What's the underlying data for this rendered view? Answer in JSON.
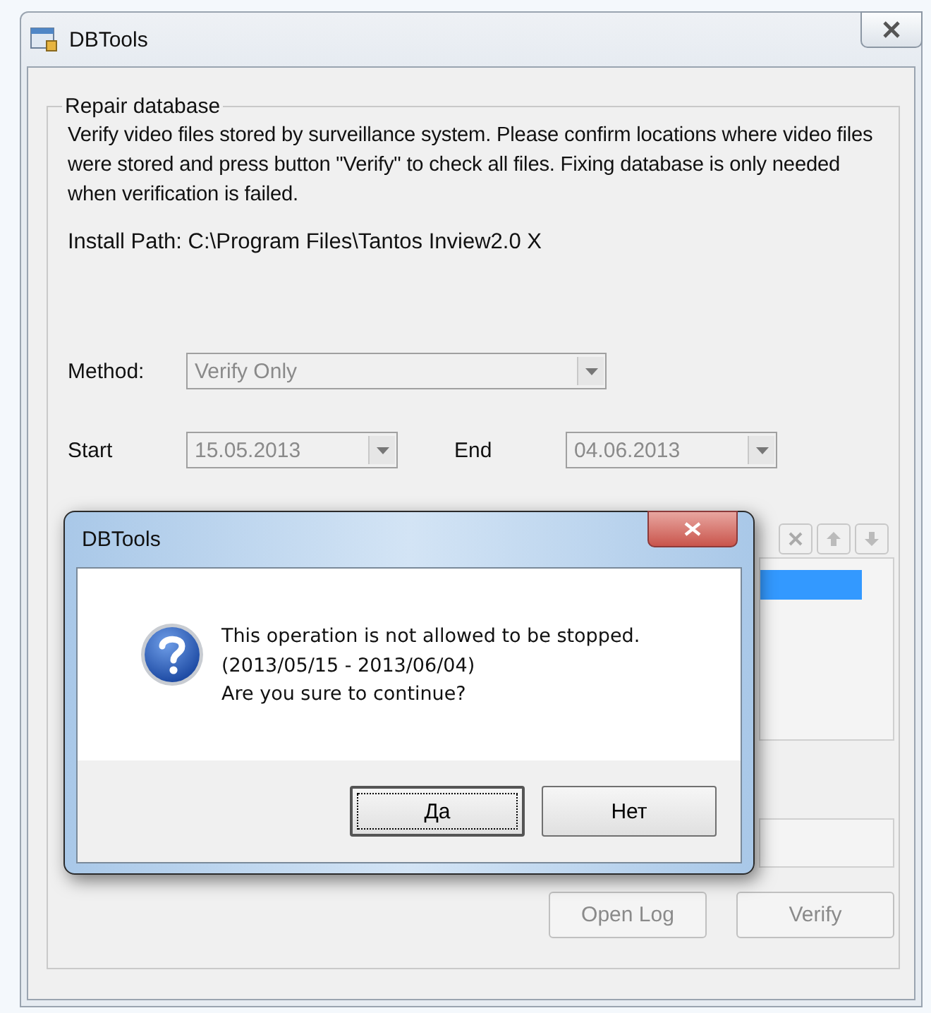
{
  "window": {
    "title": "DBTools"
  },
  "group": {
    "title": "Repair database",
    "description": "Verify video files stored by surveillance system. Please confirm locations where video files were stored and press button \"Verify\" to check all files. Fixing database is only needed when verification is failed.",
    "install_path": "Install Path: C:\\Program Files\\Tantos Inview2.0 X",
    "method": {
      "label": "Method:",
      "value": "Verify Only",
      "disabled": true
    },
    "start": {
      "label": "Start",
      "value": "15.05.2013",
      "disabled": true
    },
    "end": {
      "label": "End",
      "value": "04.06.2013",
      "disabled": true
    },
    "buttons": [
      {
        "label": "Open Log",
        "disabled": true
      },
      {
        "label": "Verify",
        "disabled": true
      }
    ]
  },
  "dialog": {
    "title": "DBTools",
    "message": [
      "This operation is not allowed to be stopped.",
      "(2013/05/15 - 2013/06/04)",
      "Are you sure to continue?"
    ],
    "buttons": [
      {
        "label": "Да",
        "focused": true
      },
      {
        "label": "Нет",
        "focused": false
      }
    ]
  }
}
